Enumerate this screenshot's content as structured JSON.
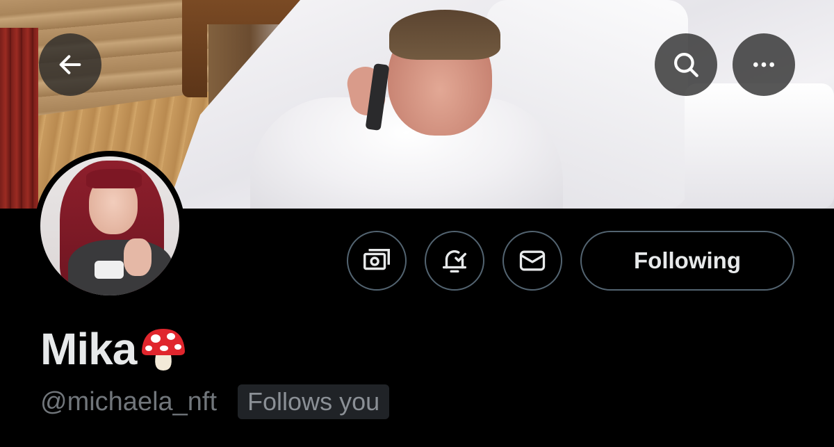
{
  "header": {
    "back_icon": "arrow-left-icon",
    "search_icon": "search-icon",
    "more_icon": "more-horizontal-icon"
  },
  "actions": {
    "tip_icon": "money-icon",
    "notify_icon": "bell-check-icon",
    "message_icon": "envelope-icon",
    "follow_label": "Following"
  },
  "profile": {
    "display_name": "Mika",
    "name_emoji_icon": "mushroom-icon",
    "handle": "@michaela_nft",
    "follows_you": "Follows you"
  },
  "colors": {
    "background": "#000000",
    "text_primary": "#e7e9ea",
    "text_secondary": "#71767b",
    "border": "#536471",
    "badge_bg": "#202327"
  }
}
